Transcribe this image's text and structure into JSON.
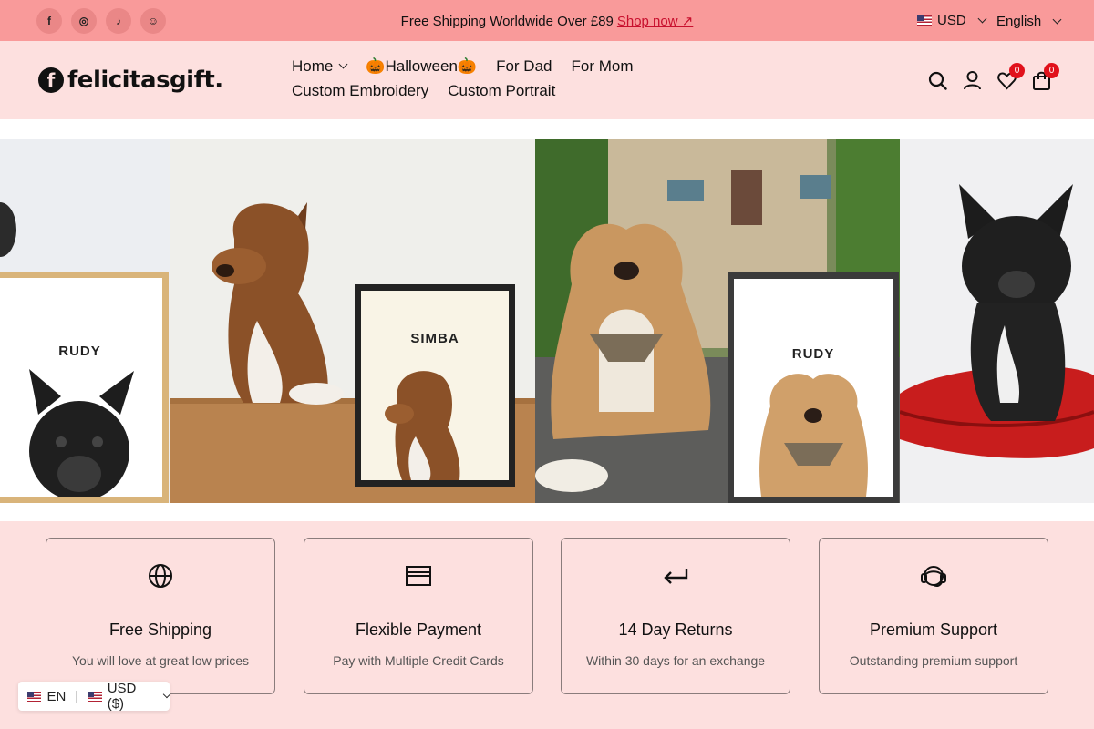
{
  "topbar": {
    "socials": [
      {
        "icon": "facebook-icon",
        "glyph": "f"
      },
      {
        "icon": "instagram-icon",
        "glyph": "◎"
      },
      {
        "icon": "tiktok-icon",
        "glyph": "♪"
      },
      {
        "icon": "snapchat-icon",
        "glyph": "☺"
      }
    ],
    "announcement": "Free Shipping Worldwide Over £89",
    "shop_now": "Shop now ↗",
    "currency": "USD",
    "language": "English"
  },
  "header": {
    "logo_mark": "f",
    "logo_text": "felicitasgift.",
    "nav": [
      {
        "label": "Home",
        "has_dropdown": true
      },
      {
        "label": "🎃Halloween🎃",
        "has_dropdown": false
      },
      {
        "label": "For Dad",
        "has_dropdown": false
      },
      {
        "label": "For Mom",
        "has_dropdown": false
      },
      {
        "label": "Custom Embroidery",
        "has_dropdown": false
      },
      {
        "label": "Custom Portrait",
        "has_dropdown": false
      }
    ],
    "wishlist_count": "0",
    "cart_count": "0"
  },
  "banner": {
    "frames": [
      "RUDY",
      "SIMBA",
      "RUDY"
    ]
  },
  "features": [
    {
      "icon": "globe-icon",
      "title": "Free Shipping",
      "subtitle": "You will love at great low prices"
    },
    {
      "icon": "credit-card-icon",
      "title": "Flexible Payment",
      "subtitle": "Pay with Multiple Credit Cards"
    },
    {
      "icon": "return-arrow-icon",
      "title": "14 Day Returns",
      "subtitle": "Within 30 days for an exchange"
    },
    {
      "icon": "headset-icon",
      "title": "Premium Support",
      "subtitle": "Outstanding premium support"
    }
  ],
  "locale_selector": {
    "language": "EN",
    "currency": "USD ($)"
  },
  "colors": {
    "topbar_bg": "#f99a9a",
    "header_bg": "#fde0df",
    "badge": "#e1111b",
    "link": "#c8102e"
  }
}
